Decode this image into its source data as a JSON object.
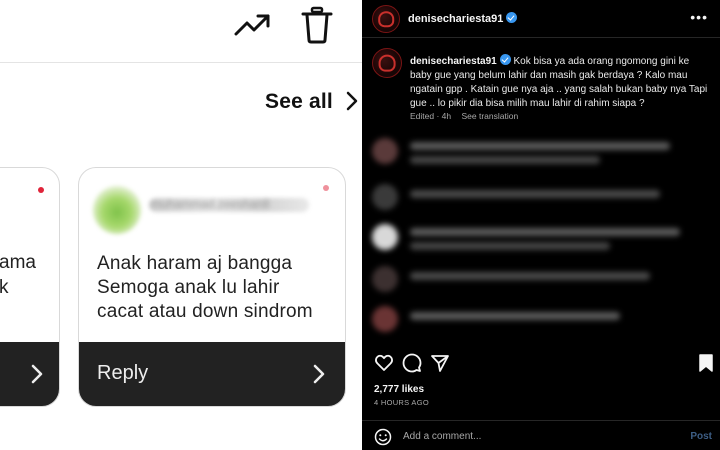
{
  "left_panel": {
    "see_all": "See all",
    "left_card_partial_text": "ama\nk",
    "card": {
      "username": "muhammad.zeeshan8",
      "comment": "Anak haram aj bangga\nSemoga anak lu lahir\ncacat atau down sindrom",
      "reply_label": "Reply"
    },
    "icons": [
      "trending-up-icon",
      "trash-icon",
      "chevron-right-icon"
    ],
    "colors": {
      "notification_dot": "#e0243a",
      "card_footer": "#222222"
    }
  },
  "right_panel": {
    "header": {
      "username": "denisechariesta91"
    },
    "post": {
      "username": "denisechariesta91",
      "caption": "Kok bisa ya ada orang ngomong gini ke baby gue yang belum lahir dan masih gak berdaya ? Kalo mau ngatain gpp . Katain gue nya aja .. yang salah bukan baby nya Tapi gue .. lo pikir dia bisa milih mau lahir di rahim siapa ?",
      "edited": "Edited · 4h",
      "see_translation": "See translation"
    },
    "likes": "2,777 likes",
    "time_ago": "4 HOURS AGO",
    "comment_placeholder": "Add a comment...",
    "post_button": "Post",
    "icons": [
      "heart-icon",
      "comment-icon",
      "share-icon",
      "bookmark-icon",
      "emoji-icon",
      "more-icon",
      "verified-badge-icon"
    ],
    "colors": {
      "verified": "#3897f0",
      "post_button": "#3d5e85"
    }
  }
}
